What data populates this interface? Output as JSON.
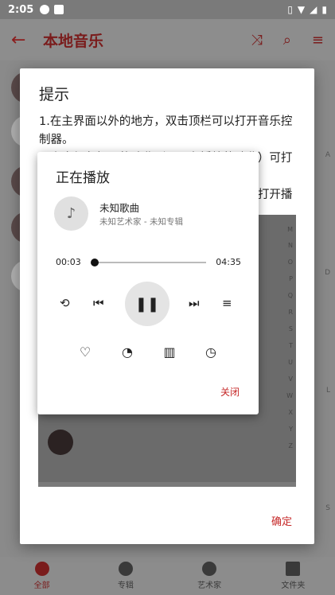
{
  "status": {
    "time": "2:05"
  },
  "appbar": {
    "title": "本地音乐"
  },
  "index_letters_right": [
    "A",
    "D",
    "L",
    "S"
  ],
  "bottom_nav": [
    {
      "label": "全部",
      "active": true
    },
    {
      "label": "专辑",
      "active": false
    },
    {
      "label": "艺术家",
      "active": false
    },
    {
      "label": "文件夹",
      "active": false
    }
  ],
  "dialog": {
    "title": "提示",
    "lines": [
      "1.在主界面以外的地方，双击顶栏可以打开音乐控制器。",
      "2.点击红色标题的歌曲（即正在播放的歌曲）可打开播放页面。",
      "3.在主界面和本界面之外，下拉工具栏亦可打开播放页面。"
    ],
    "confirm": "确定"
  },
  "shot": {
    "index_letters": [
      "M",
      "N",
      "O",
      "P",
      "Q",
      "R",
      "S",
      "T",
      "U",
      "V",
      "W",
      "X",
      "Y",
      "Z"
    ]
  },
  "player": {
    "title": "正在播放",
    "song": "未知歌曲",
    "artist": "未知艺术家 - 未知专辑",
    "current_time": "00:03",
    "total_time": "04:35",
    "progress": 0.011,
    "close": "关闭"
  },
  "accent_color": "#c62828"
}
